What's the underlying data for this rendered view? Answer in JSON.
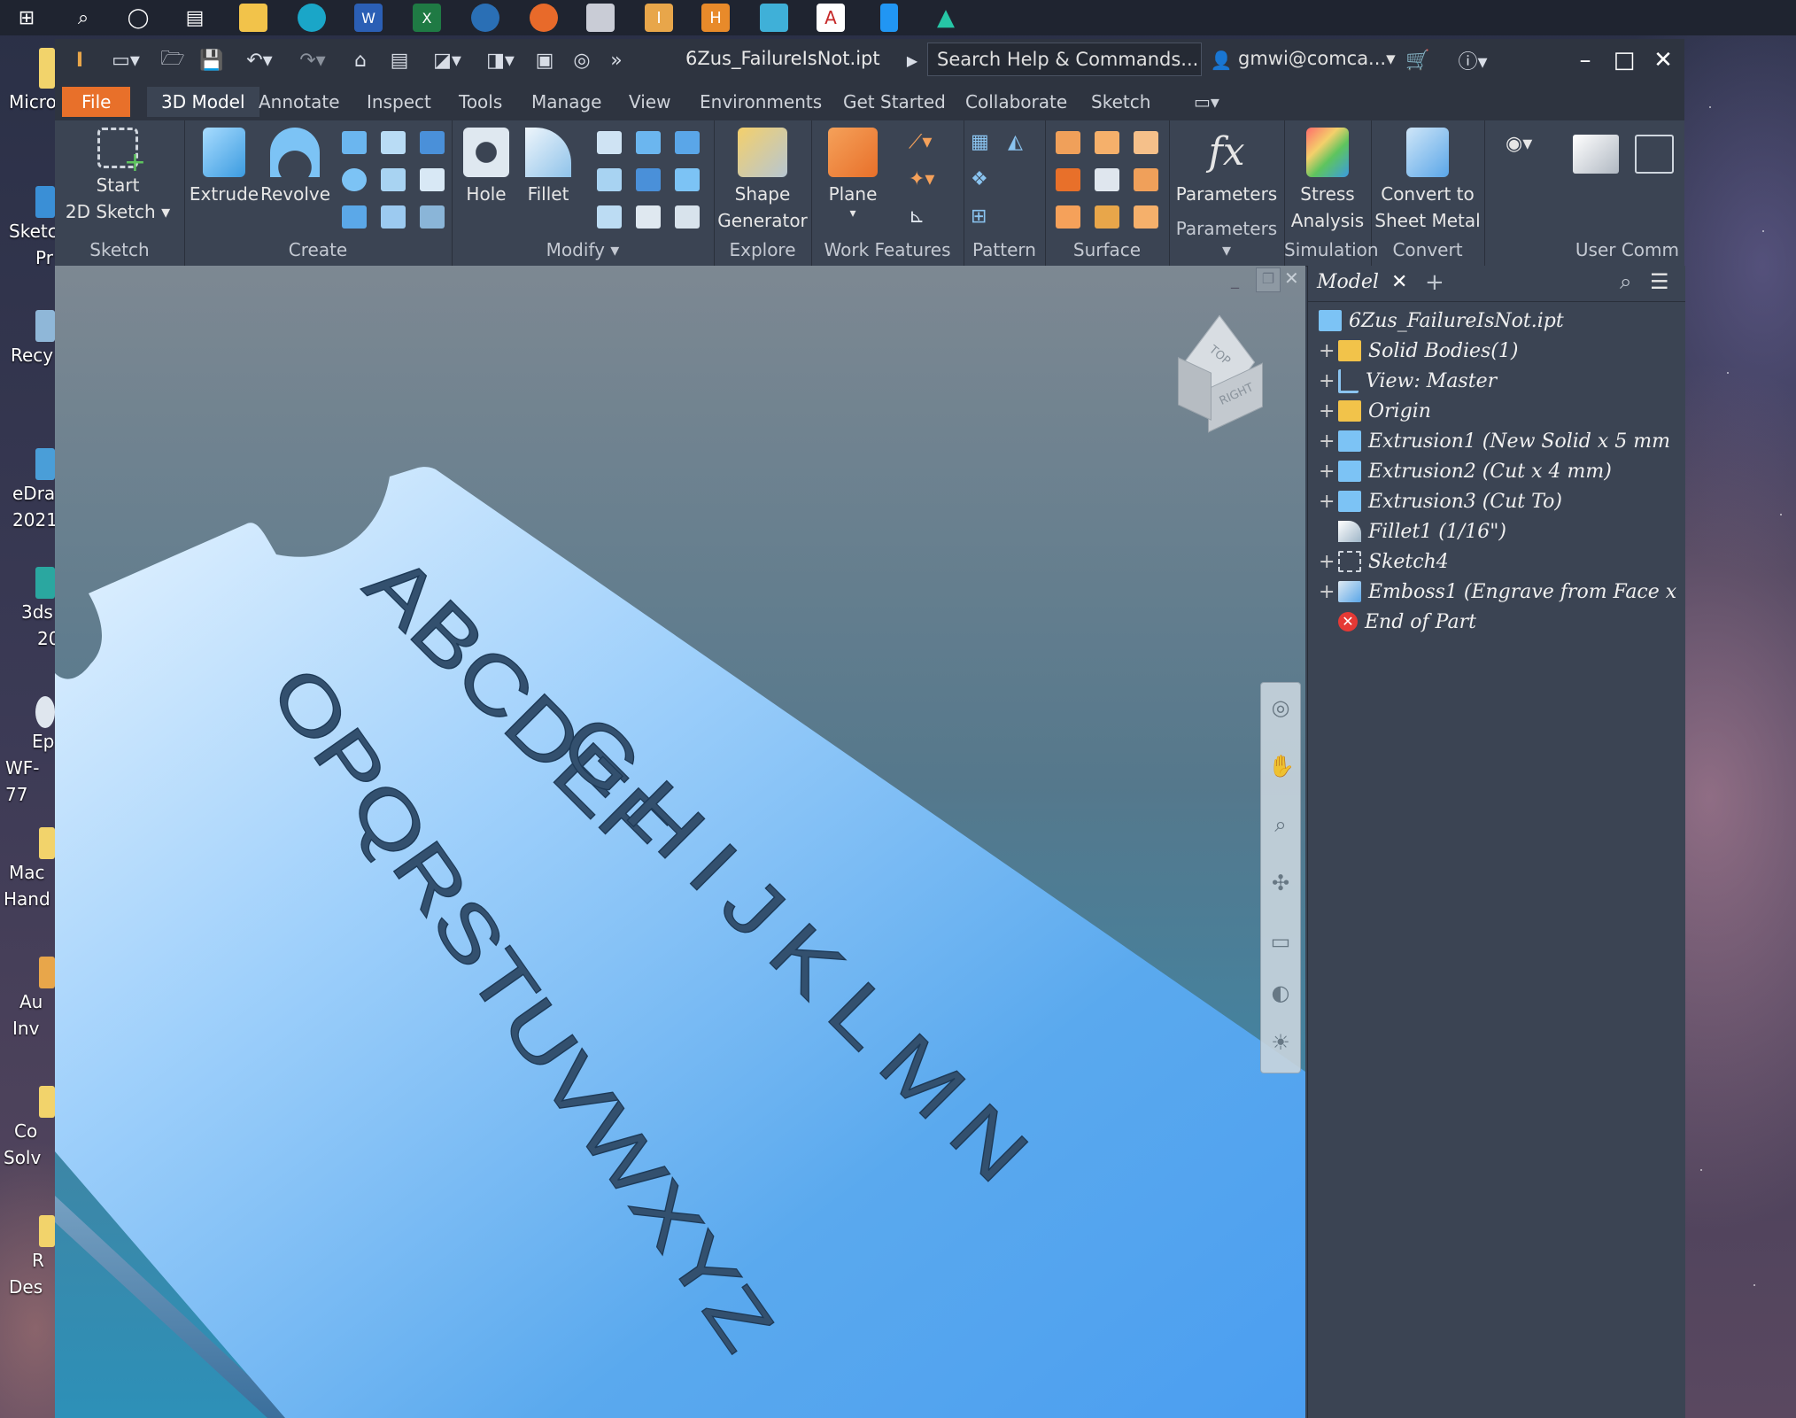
{
  "app": {
    "filename": "6Zus_FailureIsNot.ipt",
    "search_placeholder": "Search Help & Commands...",
    "user": "gmwi@comca..."
  },
  "desktop_icons": [
    {
      "label1": "Micro",
      "label2": ""
    },
    {
      "label1": "Sketc",
      "label2": "Pr"
    },
    {
      "label1": "Recy",
      "label2": ""
    },
    {
      "label1": "eDra",
      "label2": "2021"
    },
    {
      "label1": "3ds",
      "label2": "20"
    },
    {
      "label1": "Ep",
      "label2": "WF-77"
    },
    {
      "label1": "Mac",
      "label2": "Hand"
    },
    {
      "label1": "Au",
      "label2": "Inv"
    },
    {
      "label1": "Co",
      "label2": "Solv"
    },
    {
      "label1": "R",
      "label2": "Des"
    }
  ],
  "tabs": [
    "File",
    "3D Model",
    "Annotate",
    "Inspect",
    "Tools",
    "Manage",
    "View",
    "Environments",
    "Get Started",
    "Collaborate",
    "Sketch"
  ],
  "ribbon": {
    "sketch": {
      "btn1": "Start",
      "btn2": "2D Sketch",
      "label": "Sketch"
    },
    "create": {
      "extrude": "Extrude",
      "revolve": "Revolve",
      "label": "Create"
    },
    "modify": {
      "hole": "Hole",
      "fillet": "Fillet",
      "label": "Modify"
    },
    "explore": {
      "btn1": "Shape",
      "btn2": "Generator",
      "label": "Explore"
    },
    "work": {
      "plane": "Plane",
      "label": "Work Features"
    },
    "pattern": {
      "label": "Pattern"
    },
    "surface": {
      "label": "Surface"
    },
    "parameters": {
      "btn": "Parameters",
      "label": "Parameters"
    },
    "simulation": {
      "btn1": "Stress",
      "btn2": "Analysis",
      "label": "Simulation"
    },
    "convert": {
      "btn1": "Convert to",
      "btn2": "Sheet Metal",
      "label": "Convert"
    },
    "usercomm": {
      "label": "User Comm"
    }
  },
  "viewcube": {
    "top": "TOP",
    "right": "RIGHT"
  },
  "model": {
    "line1": "ABCDEF",
    "line2": "GHIJKLMN",
    "line3": "OPQRSTUVWXYZ"
  },
  "browser": {
    "title": "Model",
    "items": [
      {
        "text": "6Zus_FailureIsNot.ipt",
        "expand": ""
      },
      {
        "text": "Solid Bodies(1)",
        "expand": "+"
      },
      {
        "text": "View: Master",
        "expand": "+"
      },
      {
        "text": "Origin",
        "expand": "+"
      },
      {
        "text": "Extrusion1 (New Solid x 5 mm",
        "expand": "+"
      },
      {
        "text": "Extrusion2 (Cut x 4 mm)",
        "expand": "+"
      },
      {
        "text": "Extrusion3 (Cut To)",
        "expand": "+"
      },
      {
        "text": "Fillet1 (1/16\")",
        "expand": ""
      },
      {
        "text": "Sketch4",
        "expand": "+"
      },
      {
        "text": "Emboss1 (Engrave from Face x",
        "expand": "+"
      },
      {
        "text": "End of Part",
        "expand": ""
      }
    ]
  },
  "colors": {
    "file_tab": "#e8702a",
    "plate": "#5aa9ee",
    "viewport_top": "#7d8892"
  }
}
